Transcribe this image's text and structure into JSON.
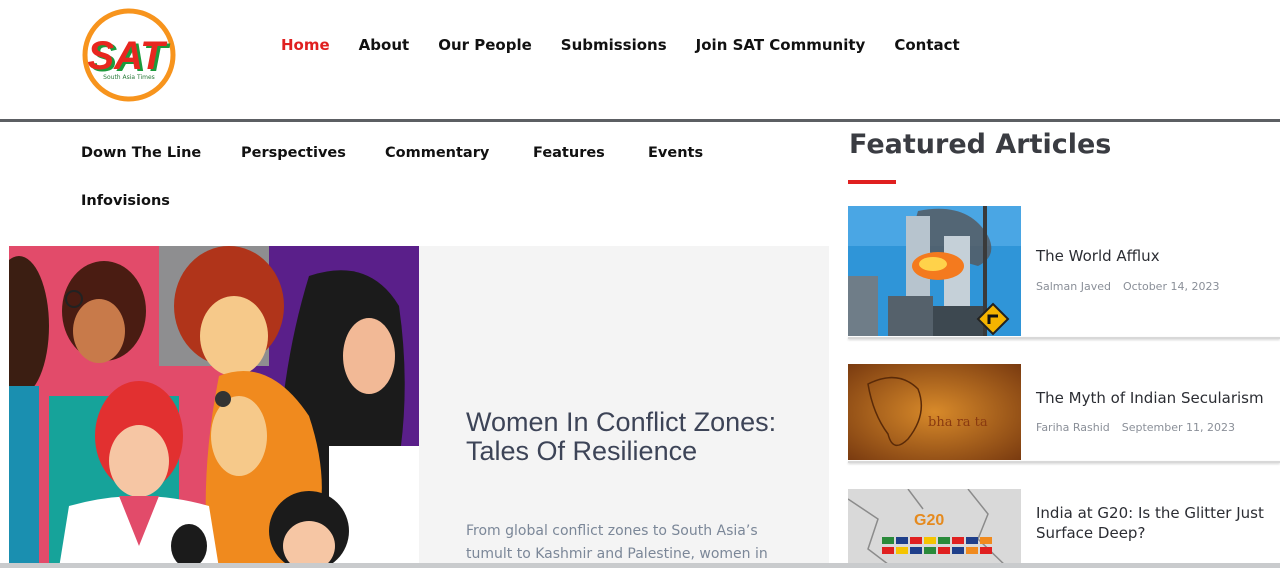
{
  "header": {
    "logo": {
      "text": "SAT",
      "subtitle": "South Asia Times"
    },
    "nav": [
      {
        "label": "Home",
        "active": true
      },
      {
        "label": "About"
      },
      {
        "label": "Our People"
      },
      {
        "label": "Submissions"
      },
      {
        "label": "Join SAT Community"
      },
      {
        "label": "Contact"
      }
    ]
  },
  "categories": [
    "Down The Line",
    "Perspectives",
    "Commentary",
    "Features",
    "Events",
    "Infovisions"
  ],
  "hero": {
    "title": "Women In Conflict Zones: Tales Of Resilience",
    "excerpt": "From global conflict zones to South Asia’s tumult to Kashmir and Palestine, women in"
  },
  "featured": {
    "heading": "Featured Articles",
    "articles": [
      {
        "title": "The World Afflux",
        "author": "Salman Javed",
        "date": "October 14, 2023"
      },
      {
        "title": "The Myth of Indian Secularism",
        "author": "Fariha Rashid",
        "date": "September 11, 2023",
        "thumb_text": "bha ra ta"
      },
      {
        "title": "India at G20: Is the Glitter Just Surface Deep?",
        "author": "",
        "date": "",
        "thumb_text": "G20"
      }
    ]
  },
  "colors": {
    "accent": "#e02020",
    "text": "#111111",
    "hero_bg": "#f4f4f4"
  }
}
